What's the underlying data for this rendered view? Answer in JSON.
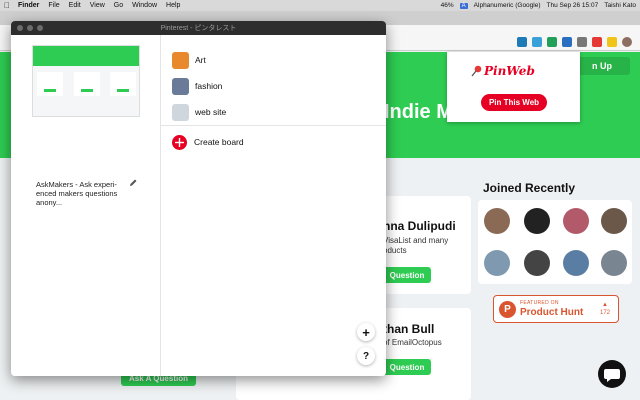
{
  "menubar": {
    "apple": "",
    "items": [
      "Finder",
      "File",
      "Edit",
      "View",
      "Go",
      "Window",
      "Help"
    ],
    "input_source": "A",
    "input_source_name": "Alphanumeric (Google)",
    "battery": "46%",
    "clock": "Thu Sep 26  15:07",
    "user": "Taishi Kato"
  },
  "pinterest_window": {
    "title": "Pinterest - ピンタレスト",
    "pin_description": "AskMakers - Ask experi-enced makers questions anony...",
    "boards": [
      {
        "label": "Art",
        "color": "#e7892c"
      },
      {
        "label": "fashion",
        "color": "#6a7a99"
      },
      {
        "label": "web site",
        "color": "#cfd6dd"
      }
    ],
    "create_board_label": "Create board",
    "add_button": "+",
    "help_button": "?"
  },
  "pinweb": {
    "logo": "PinWeb",
    "button": "Pin This Web"
  },
  "page": {
    "hero_title": "Indie Ma",
    "signup": "n Up",
    "maker1_name": "nna Dulipudi",
    "maker1_sub1": "VisaList and many",
    "maker1_sub2": "oducts",
    "maker1_btn": "Question",
    "maker2_name": "than Bull",
    "maker2_sub": "of EmailOctopus",
    "maker2_btn": "Question",
    "bottom_btn": "Ask A Question",
    "joined_title": "Joined Recently",
    "ph_featured": "FEATURED ON",
    "ph_name": "Product Hunt",
    "ph_arrow": "▲",
    "ph_count": "172",
    "ph_logo": "P"
  },
  "colors": {
    "brand_green": "#2ecc52",
    "pinterest_red": "#e60023",
    "product_hunt": "#da552f"
  }
}
